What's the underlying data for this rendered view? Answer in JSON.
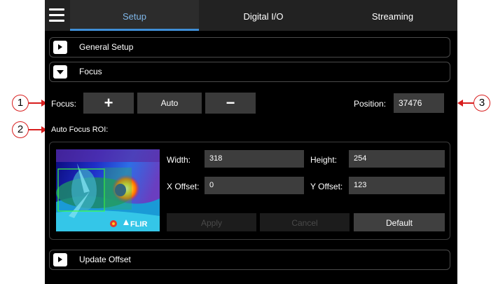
{
  "tabs": [
    {
      "label": "Setup"
    },
    {
      "label": "Digital I/O"
    },
    {
      "label": "Streaming"
    }
  ],
  "sections": {
    "general_setup": "General Setup",
    "focus": "Focus",
    "update_offset": "Update Offset"
  },
  "focus": {
    "label": "Focus:",
    "plus": "+",
    "auto": "Auto",
    "minus": "−",
    "position_label": "Position:",
    "position_value": "37476",
    "auto_focus_roi_label": "Auto Focus ROI:"
  },
  "roi": {
    "width_label": "Width:",
    "width_value": "318",
    "height_label": "Height:",
    "height_value": "254",
    "x_offset_label": "X Offset:",
    "x_offset_value": "0",
    "y_offset_label": "Y Offset:",
    "y_offset_value": "123",
    "apply": "Apply",
    "cancel": "Cancel",
    "default": "Default",
    "logo_text": "FLIR"
  },
  "callouts": [
    "1",
    "2",
    "3"
  ],
  "colors": {
    "accent": "#3f8ed6",
    "callout_red": "#d81e1e",
    "panel_bg": "#000000",
    "button_bg": "#3a3a3a"
  },
  "icons": {
    "menu": "hamburger-icon",
    "expand": "triangle-right-icon",
    "collapse": "triangle-down-icon"
  }
}
